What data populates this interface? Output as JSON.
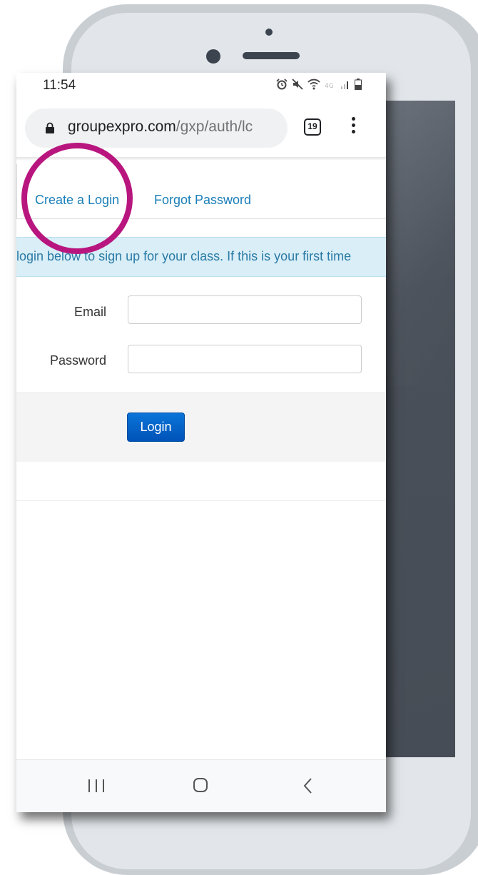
{
  "status_bar": {
    "time": "11:54",
    "icons": [
      "alarm-icon",
      "mute-icon",
      "wifi-icon",
      "4g-icon",
      "signal-icon",
      "battery-icon"
    ]
  },
  "browser": {
    "url_host": "groupexpro.com",
    "url_path": "/gxp/auth/lc",
    "tab_count": "19"
  },
  "page": {
    "tabs": [
      {
        "label": "Create a Login"
      },
      {
        "label": "Forgot Password"
      }
    ],
    "info_text": "login below to sign up for your class. If this is your first time",
    "email_label": "Email",
    "password_label": "Password",
    "email_value": "",
    "password_value": "",
    "login_button": "Login"
  },
  "annotation": {
    "highlight_color": "#b8167e",
    "target": "Create a Login"
  },
  "colors": {
    "link": "#1a7fb8",
    "banner_bg": "#d9eef7",
    "button": "#0a6ad0"
  }
}
